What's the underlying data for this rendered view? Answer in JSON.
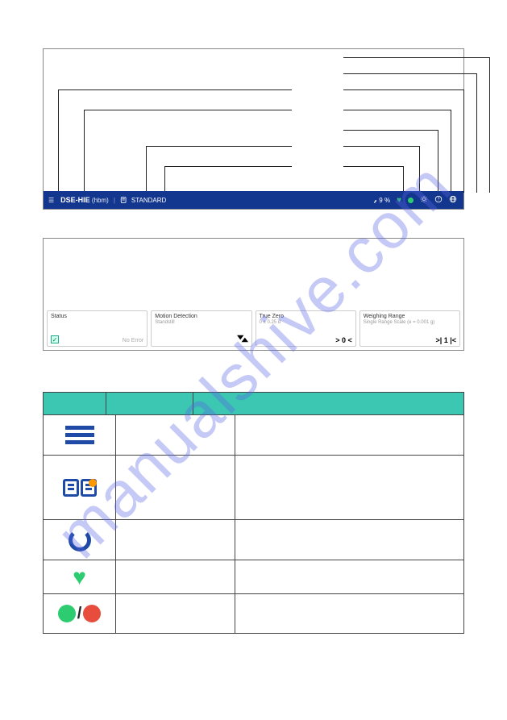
{
  "watermark": "manualshive.com",
  "toolbar": {
    "title": "DSE-HIE",
    "suffix": "(hbm)",
    "mode": "STANDARD",
    "percent": "9 %"
  },
  "cards": [
    {
      "title": "Status",
      "sub": "",
      "footer": "No Error"
    },
    {
      "title": "Motion Detection",
      "sub": "Standstill",
      "icon": "▼▲"
    },
    {
      "title": "True Zero",
      "sub": "0 ± 0.25 d",
      "icon": "> 0 <"
    },
    {
      "title": "Weighing Range",
      "sub": "Single Range Scale (e = 0.001 g)",
      "icon": ">| 1 |<"
    }
  ]
}
